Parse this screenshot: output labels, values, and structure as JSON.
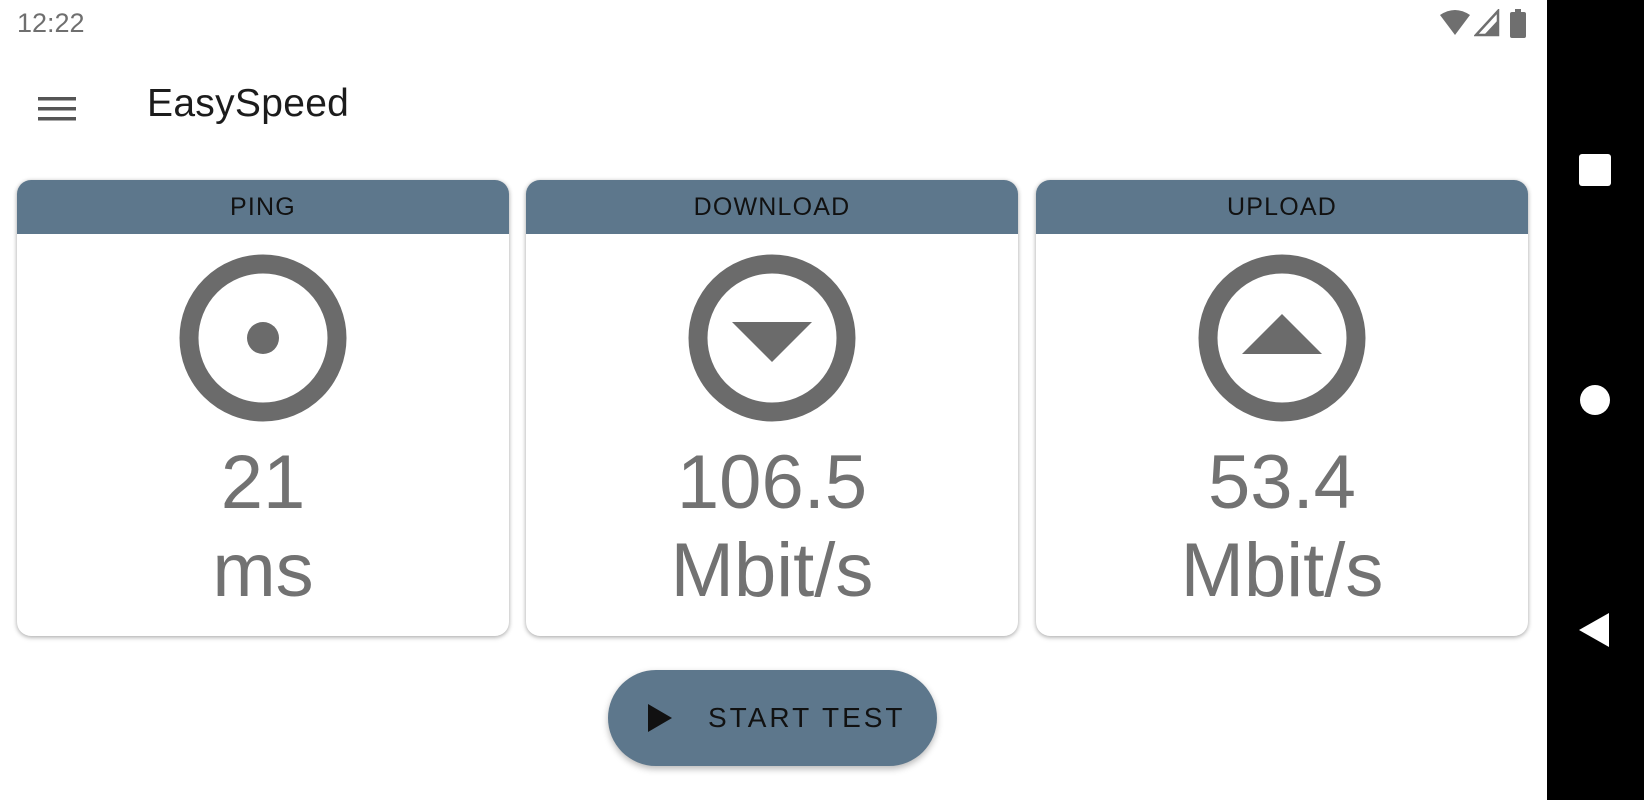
{
  "status_bar": {
    "time": "12:22",
    "icons": [
      "wifi-icon",
      "signal-icon",
      "battery-icon"
    ]
  },
  "app_bar": {
    "menu_icon": "hamburger-menu-icon",
    "title": "EasySpeed"
  },
  "cards": [
    {
      "header": "PING",
      "icon": "ping-target-icon",
      "value": "21",
      "unit": "ms"
    },
    {
      "header": "DOWNLOAD",
      "icon": "download-arrow-icon",
      "value": "106.5",
      "unit": "Mbit/s"
    },
    {
      "header": "UPLOAD",
      "icon": "upload-arrow-icon",
      "value": "53.4",
      "unit": "Mbit/s"
    }
  ],
  "start_button": {
    "icon": "play-icon",
    "label": "START TEST"
  },
  "nav_bar": {
    "buttons": [
      "recents-square-icon",
      "home-circle-icon",
      "back-triangle-icon"
    ]
  },
  "colors": {
    "accent": "#5d778c",
    "icon_gray": "#6b6b6b",
    "value_gray": "#727272",
    "nav_bg": "#000000"
  }
}
